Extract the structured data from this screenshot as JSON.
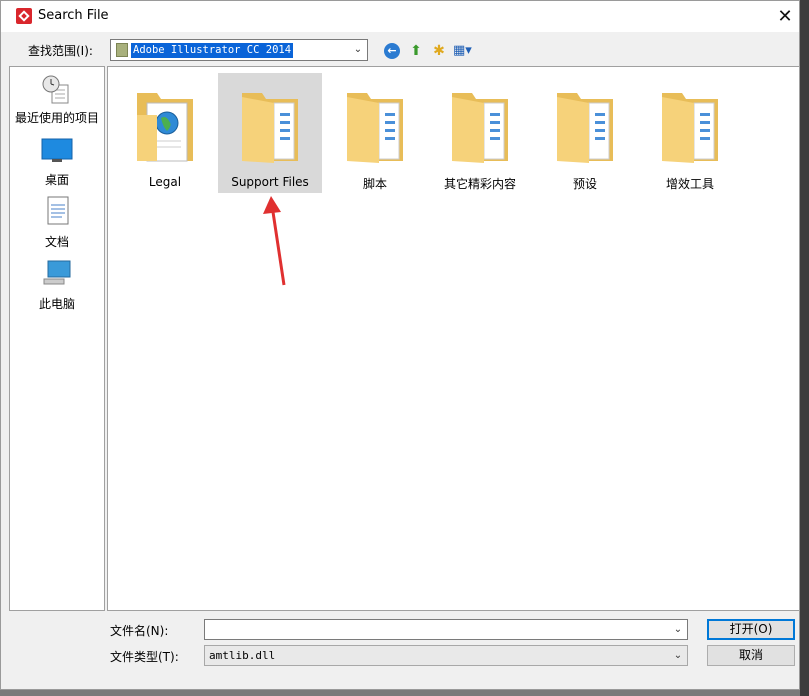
{
  "window": {
    "title": "Search File"
  },
  "lookin": {
    "label": "查找范围(I):",
    "value": "Adobe Illustrator CC 2014"
  },
  "sidebar": {
    "items": [
      {
        "label": "最近使用的项目",
        "icon": "recent-items-icon"
      },
      {
        "label": "桌面",
        "icon": "desktop-icon"
      },
      {
        "label": "文档",
        "icon": "documents-icon"
      },
      {
        "label": "此电脑",
        "icon": "this-pc-icon"
      }
    ]
  },
  "files": [
    {
      "label": "Legal",
      "type": "folder-globe",
      "selected": false
    },
    {
      "label": "Support Files",
      "type": "folder",
      "selected": true
    },
    {
      "label": "脚本",
      "type": "folder",
      "selected": false
    },
    {
      "label": "其它精彩内容",
      "type": "folder",
      "selected": false
    },
    {
      "label": "预设",
      "type": "folder",
      "selected": false
    },
    {
      "label": "增效工具",
      "type": "folder",
      "selected": false
    }
  ],
  "filename": {
    "label": "文件名(N):",
    "value": ""
  },
  "filetype": {
    "label": "文件类型(T):",
    "value": "amtlib.dll"
  },
  "buttons": {
    "open": "打开(O)",
    "cancel": "取消"
  },
  "colors": {
    "folder": "#f6d27a",
    "selection": "#d9d9d9",
    "highlight": "#0a64d8",
    "arrow": "#e03030"
  }
}
